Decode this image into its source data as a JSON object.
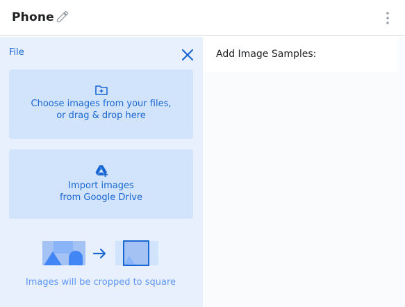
{
  "header": {
    "title": "Phone",
    "edit_icon": "pencil-icon",
    "menu_icon": "more-vert-icon"
  },
  "upload_panel": {
    "label": "File",
    "close_icon": "close-icon",
    "choose_files": {
      "icon": "folder-add-icon",
      "line1": "Choose images from your files,",
      "line2": "or drag & drop here"
    },
    "import_drive": {
      "icon": "google-drive-icon",
      "line1": "Import images",
      "line2": "from Google Drive"
    },
    "crop_note": "Images will be cropped to square"
  },
  "samples_panel": {
    "title": "Add Image Samples:"
  },
  "colors": {
    "accent": "#1967d2",
    "panel_bg": "#e8f0fe",
    "card_bg": "#d2e3fc",
    "muted_blue": "#5e97f6"
  }
}
